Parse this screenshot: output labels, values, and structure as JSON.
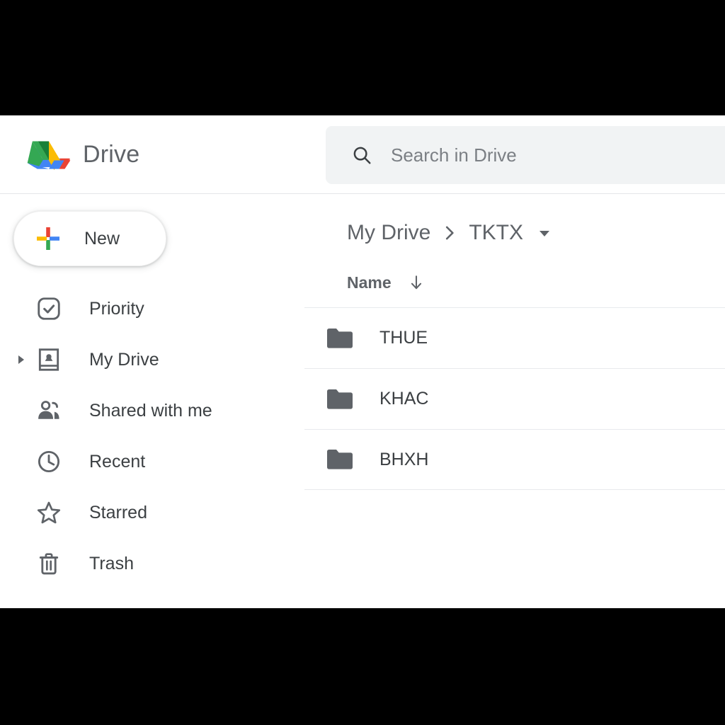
{
  "app": {
    "brand_name": "Drive",
    "logo_icon": "google-drive-logo",
    "colors": {
      "drive_blue": "#4285f4",
      "drive_green": "#34a853",
      "drive_yellow": "#fbbc04",
      "drive_red": "#ea4335",
      "text_primary": "#3c4043",
      "text_secondary": "#5f6368",
      "search_bg": "#f1f3f4",
      "divider": "#e8eaed",
      "folder_icon": "#5f6368"
    }
  },
  "search": {
    "icon": "search-icon",
    "placeholder": "Search in Drive",
    "value": ""
  },
  "sidebar": {
    "new_button": {
      "label": "New",
      "icon": "plus-icon"
    },
    "items": [
      {
        "label": "Priority",
        "icon": "check-circle-icon",
        "expandable": false
      },
      {
        "label": "My Drive",
        "icon": "my-drive-icon",
        "expandable": true
      },
      {
        "label": "Shared with me",
        "icon": "people-icon",
        "expandable": false
      },
      {
        "label": "Recent",
        "icon": "clock-icon",
        "expandable": false
      },
      {
        "label": "Starred",
        "icon": "star-icon",
        "expandable": false
      },
      {
        "label": "Trash",
        "icon": "trash-icon",
        "expandable": false
      }
    ]
  },
  "main": {
    "breadcrumb": {
      "root": "My Drive",
      "separator_icon": "chevron-right-icon",
      "current": "TKTX",
      "dropdown_icon": "caret-down-icon"
    },
    "list": {
      "columns": [
        {
          "label": "Name",
          "sort_icon": "arrow-down-icon",
          "sorted": true
        }
      ],
      "rows": [
        {
          "name": "THUE",
          "icon": "folder-icon",
          "type": "folder"
        },
        {
          "name": "KHAC",
          "icon": "folder-icon",
          "type": "folder"
        },
        {
          "name": "BHXH",
          "icon": "folder-icon",
          "type": "folder"
        }
      ]
    }
  }
}
